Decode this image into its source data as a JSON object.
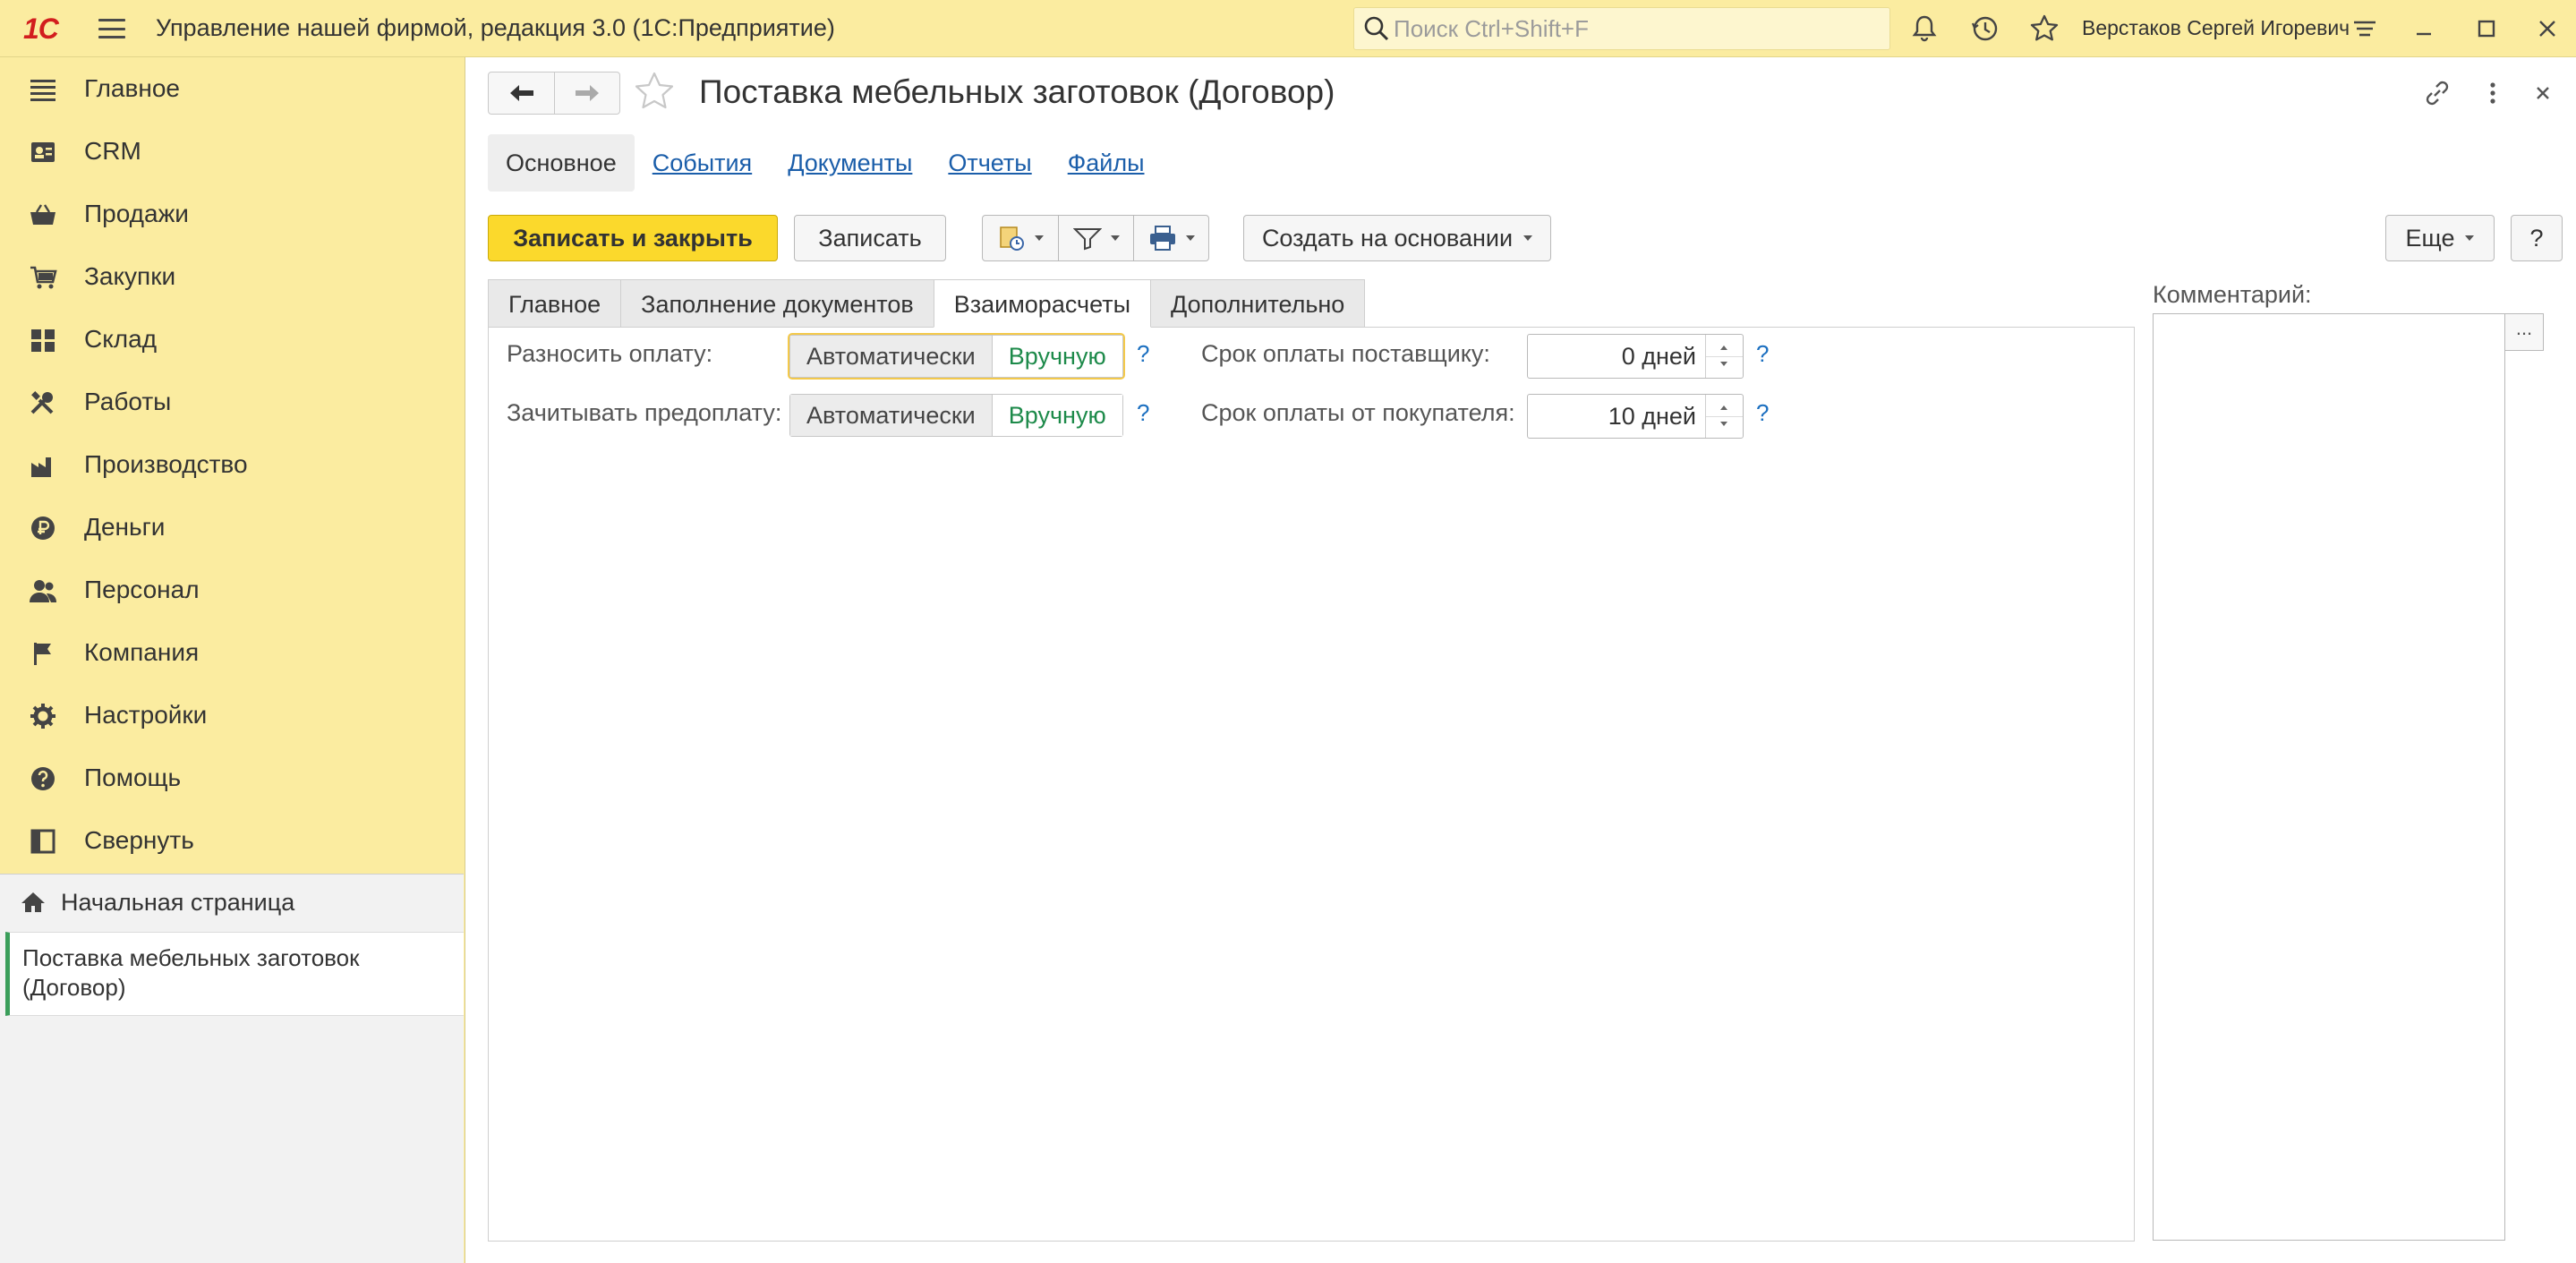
{
  "app": {
    "logo_text": "1С",
    "title": "Управление нашей фирмой, редакция 3.0  (1С:Предприятие)",
    "search_placeholder": "Поиск Ctrl+Shift+F",
    "user_name": "Верстаков Сергей Игоревич",
    "accent_color": "#fbeca0",
    "primary_button_color": "#fbd92c"
  },
  "sidebar": {
    "items": [
      {
        "label": "Главное",
        "icon": "list-icon"
      },
      {
        "label": "CRM",
        "icon": "contacts-icon"
      },
      {
        "label": "Продажи",
        "icon": "basket-icon"
      },
      {
        "label": "Закупки",
        "icon": "cart-icon"
      },
      {
        "label": "Склад",
        "icon": "grid-icon"
      },
      {
        "label": "Работы",
        "icon": "tools-icon"
      },
      {
        "label": "Производство",
        "icon": "factory-icon"
      },
      {
        "label": "Деньги",
        "icon": "ruble-icon"
      },
      {
        "label": "Персонал",
        "icon": "people-icon"
      },
      {
        "label": "Компания",
        "icon": "flag-icon"
      },
      {
        "label": "Настройки",
        "icon": "gear-icon"
      },
      {
        "label": "Помощь",
        "icon": "help-icon"
      },
      {
        "label": "Свернуть",
        "icon": "collapse-icon"
      }
    ],
    "home": "Начальная страница",
    "open_document": "Поставка мебельных заготовок (Договор)"
  },
  "form": {
    "title": "Поставка мебельных заготовок (Договор)",
    "section_tabs": [
      {
        "label": "Основное",
        "active": true
      },
      {
        "label": "События",
        "active": false
      },
      {
        "label": "Документы",
        "active": false
      },
      {
        "label": "Отчеты",
        "active": false
      },
      {
        "label": "Файлы",
        "active": false
      }
    ],
    "commands": {
      "save_close": "Записать и закрыть",
      "save": "Записать",
      "create_based": "Создать на основании",
      "more": "Еще",
      "help": "?"
    },
    "page_tabs": [
      {
        "label": "Главное",
        "active": false
      },
      {
        "label": "Заполнение документов",
        "active": false
      },
      {
        "label": "Взаиморасчеты",
        "active": true
      },
      {
        "label": "Дополнительно",
        "active": false
      }
    ],
    "fields": {
      "payment_allocation": {
        "label": "Разносить оплату:",
        "options": [
          "Автоматически",
          "Вручную"
        ],
        "selected": "Вручную"
      },
      "prepayment_offset": {
        "label": "Зачитывать предоплату:",
        "options": [
          "Автоматически",
          "Вручную"
        ],
        "selected": "Вручную"
      },
      "supplier_term": {
        "label": "Срок оплаты поставщику:",
        "value": "0 дней"
      },
      "customer_term": {
        "label": "Срок оплаты от покупателя:",
        "value": "10 дней"
      },
      "help_mark": "?"
    },
    "comment": {
      "label": "Комментарий:",
      "value": "",
      "button": "..."
    }
  }
}
